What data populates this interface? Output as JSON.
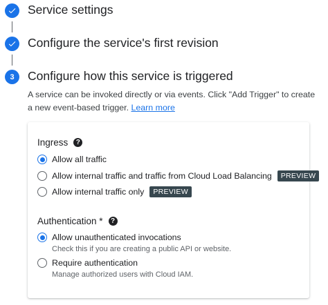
{
  "steps": [
    {
      "title": "Service settings",
      "status": "completed"
    },
    {
      "title": "Configure the service's first revision",
      "status": "completed"
    },
    {
      "number": "3",
      "title": "Configure how this service is triggered",
      "status": "active"
    }
  ],
  "description": {
    "text": "A service can be invoked directly or via events. Click \"Add Trigger\" to create a new event-based trigger.",
    "link": "Learn more"
  },
  "ingress": {
    "title": "Ingress",
    "help_icon": "help-circle-icon",
    "options": [
      {
        "label": "Allow all traffic",
        "checked": true
      },
      {
        "label": "Allow internal traffic and traffic from Cloud Load Balancing",
        "badge": "PREVIEW",
        "checked": false
      },
      {
        "label": "Allow internal traffic only",
        "badge": "PREVIEW",
        "checked": false
      }
    ]
  },
  "authentication": {
    "title": "Authentication *",
    "help_icon": "help-circle-icon",
    "options": [
      {
        "label": "Allow unauthenticated invocations",
        "hint": "Check this if you are creating a public API or website.",
        "checked": true
      },
      {
        "label": "Require authentication",
        "hint": "Manage authorized users with Cloud IAM.",
        "checked": false
      }
    ]
  },
  "colors": {
    "accent": "#1a73e8",
    "badge": "#37474f",
    "text": "#202124",
    "muted": "#5f6368"
  }
}
